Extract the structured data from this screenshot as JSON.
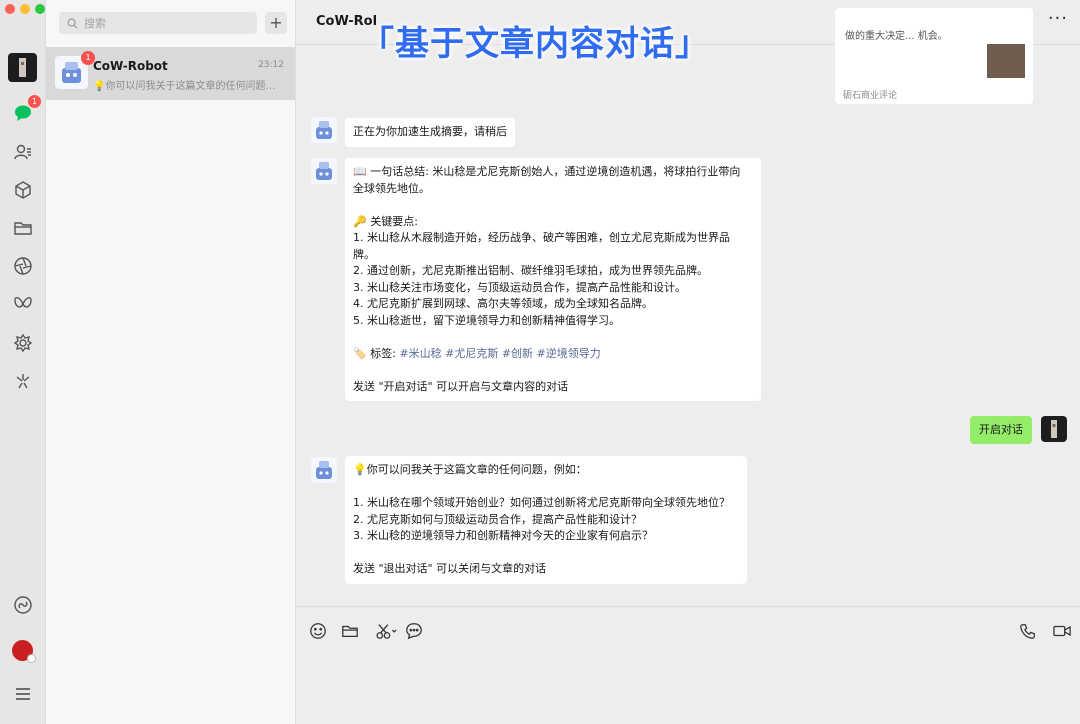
{
  "search": {
    "placeholder": "搜索",
    "add_label": "+"
  },
  "rail": {
    "chat_badge": "1"
  },
  "conversation": {
    "name": "CoW-Robot",
    "time": "23:12",
    "badge": "1",
    "preview": "💡你可以问我关于这篇文章的任何问题，例如："
  },
  "header": {
    "title": "CoW-Robot",
    "more": "···"
  },
  "overlay_title": "「基于文章内容对话」",
  "link_card": {
    "desc_line1": "做的重大决定...",
    "desc_line2": "机会。",
    "source": "砺石商业评论"
  },
  "messages": {
    "m1": {
      "text": "正在为你加速生成摘要，请稍后"
    },
    "m2": {
      "lines": [
        "📖 一句话总结: 米山稔是尤尼克斯创始人，通过逆境创造机遇，将球拍行业带向",
        "全球领先地位。",
        "",
        "🔑 关键要点:",
        "1. 米山稔从木屐制造开始，经历战争、破产等困难，创立尤尼克斯成为世界品",
        "牌。",
        "2. 通过创新，尤尼克斯推出铝制、碳纤维羽毛球拍，成为世界领先品牌。",
        "3. 米山稔关注市场变化，与顶级运动员合作，提高产品性能和设计。",
        "4. 尤尼克斯扩展到网球、高尔夫等领域，成为全球知名品牌。",
        "5. 米山稔逝世，留下逆境领导力和创新精神值得学习。",
        ""
      ],
      "tags_label": "🏷️ 标签:",
      "tags": "#米山稔 #尤尼克斯 #创新 #逆境领导力",
      "footer": "发送 \"开启对话\" 可以开启与文章内容的对话"
    },
    "me": {
      "text": "开启对话"
    },
    "m3": {
      "lines": [
        "💡你可以问我关于这篇文章的任何问题，例如：",
        "",
        "1. 米山稔在哪个领域开始创业？如何通过创新将尤尼克斯带向全球领先地位？",
        "2. 尤尼克斯如何与顶级运动员合作，提高产品性能和设计？",
        "3. 米山稔的逆境领导力和创新精神对今天的企业家有何启示？",
        "",
        "发送 \"退出对话\" 可以关闭与文章的对话"
      ]
    }
  }
}
